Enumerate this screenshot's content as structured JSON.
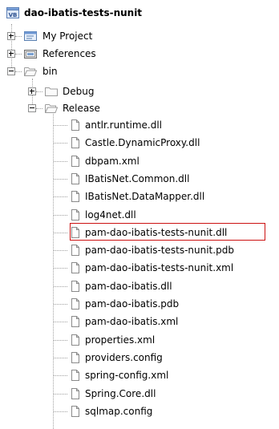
{
  "project": {
    "name": "dao-ibatis-tests-nunit",
    "icon": "vb-project-icon"
  },
  "nodes": [
    {
      "label": "My Project",
      "icon": "properties-icon",
      "expanded": false
    },
    {
      "label": "References",
      "icon": "references-icon",
      "expanded": false
    },
    {
      "label": "bin",
      "icon": "folder-open-icon",
      "expanded": true
    }
  ],
  "bin_children": [
    {
      "label": "Debug",
      "icon": "folder-icon",
      "expanded": false
    },
    {
      "label": "Release",
      "icon": "folder-open-icon",
      "expanded": true
    }
  ],
  "release_files": [
    {
      "label": "antlr.runtime.dll"
    },
    {
      "label": "Castle.DynamicProxy.dll"
    },
    {
      "label": "dbpam.xml"
    },
    {
      "label": "IBatisNet.Common.dll"
    },
    {
      "label": "IBatisNet.DataMapper.dll"
    },
    {
      "label": "log4net.dll"
    },
    {
      "label": "pam-dao-ibatis-tests-nunit.dll",
      "highlighted": true
    },
    {
      "label": "pam-dao-ibatis-tests-nunit.pdb"
    },
    {
      "label": "pam-dao-ibatis-tests-nunit.xml"
    },
    {
      "label": "pam-dao-ibatis.dll"
    },
    {
      "label": "pam-dao-ibatis.pdb"
    },
    {
      "label": "pam-dao-ibatis.xml"
    },
    {
      "label": "properties.xml"
    },
    {
      "label": "providers.config"
    },
    {
      "label": "spring-config.xml"
    },
    {
      "label": "Spring.Core.dll"
    },
    {
      "label": "sqlmap.config"
    }
  ],
  "colors": {
    "highlight_border": "#cc1111",
    "tree_lines": "#a0a0a0",
    "folder": "#f3d575"
  }
}
